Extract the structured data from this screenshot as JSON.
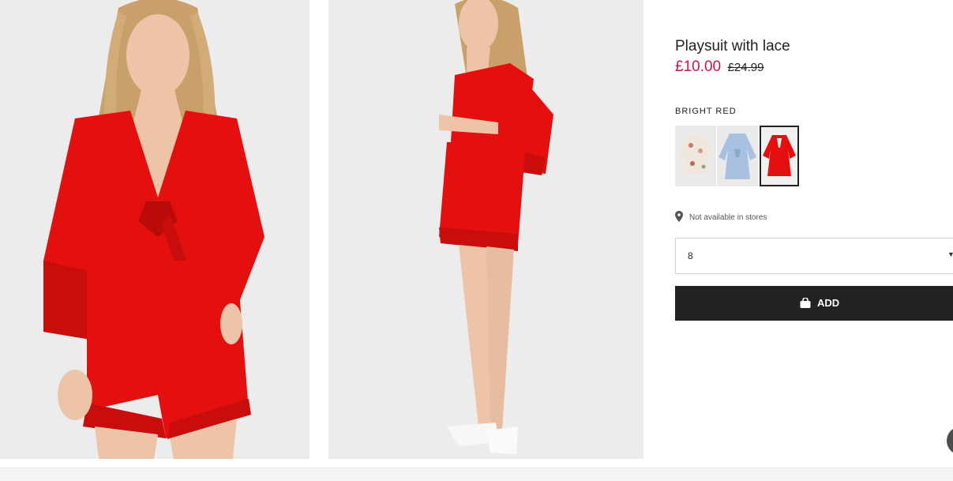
{
  "product": {
    "title": "Playsuit with lace",
    "price_sale": "£10.00",
    "price_original": "£24.99",
    "color_label": "BRIGHT RED",
    "swatches": [
      {
        "name": "floral",
        "selected": false,
        "color": "#efe6dc"
      },
      {
        "name": "light-blue",
        "selected": false,
        "color": "#a8c1e0"
      },
      {
        "name": "bright-red",
        "selected": true,
        "color": "#e3100f"
      }
    ],
    "store_availability": "Not available in stores",
    "size_select": {
      "value": "8"
    },
    "add_label": "ADD"
  },
  "colors": {
    "sale": "#d01345",
    "button": "#222222",
    "garment": "#e3100f",
    "photo_bg": "#ececec"
  },
  "icons": {
    "store": "location-pin-icon",
    "button": "shopping-bag-icon",
    "select": "chevron-down-icon"
  }
}
